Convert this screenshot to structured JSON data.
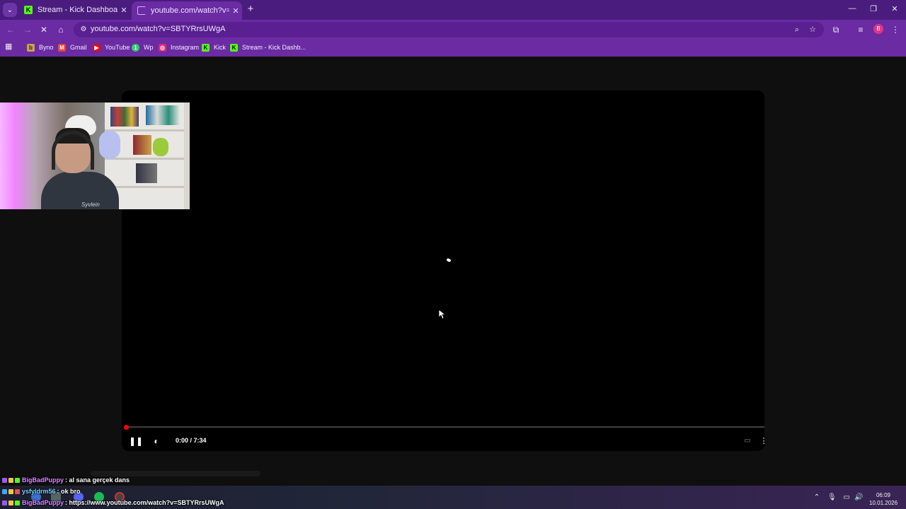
{
  "browser": {
    "tabs": [
      {
        "title": "Stream - Kick Dashboard",
        "favicon": "kick-icon",
        "active": false
      },
      {
        "title": "youtube.com/watch?v=SBTYRrs",
        "favicon": "loading-icon",
        "active": true
      }
    ],
    "new_tab": "+",
    "url": "youtube.com/watch?v=SBTYRrsUWgA",
    "profile_initial": "B",
    "bookmarks": [
      {
        "label": "Byno",
        "icon": "byno-icon"
      },
      {
        "label": "Gmail",
        "icon": "gmail-icon"
      },
      {
        "label": "YouTube",
        "icon": "youtube-icon"
      },
      {
        "label": "Wp",
        "icon": "whatsapp-icon"
      },
      {
        "label": "Instagram",
        "icon": "instagram-icon"
      },
      {
        "label": "Kick",
        "icon": "kick-icon"
      },
      {
        "label": "Stream - Kick Dashb...",
        "icon": "kick-icon"
      }
    ]
  },
  "player": {
    "time": "0:00 / 7:34",
    "progress": 0
  },
  "chat": [
    {
      "user": "BigBadPuppy",
      "message": ": al sana gerçek dans"
    },
    {
      "user": "ysfyldrm56",
      "message": ": ok bro"
    },
    {
      "user": "BigBadPuppy",
      "message": ": https://www.youtube.com/watch?v=SBTYRrsUWgA"
    }
  ],
  "webcam": {
    "shirt_text": "Syvlein"
  },
  "taskbar": {
    "time": "06:09",
    "date": "10.01.2026"
  },
  "colors": {
    "browser_frame": "#6a2ba3",
    "progress_red": "#ff0000",
    "kick_green": "#53fc18"
  }
}
